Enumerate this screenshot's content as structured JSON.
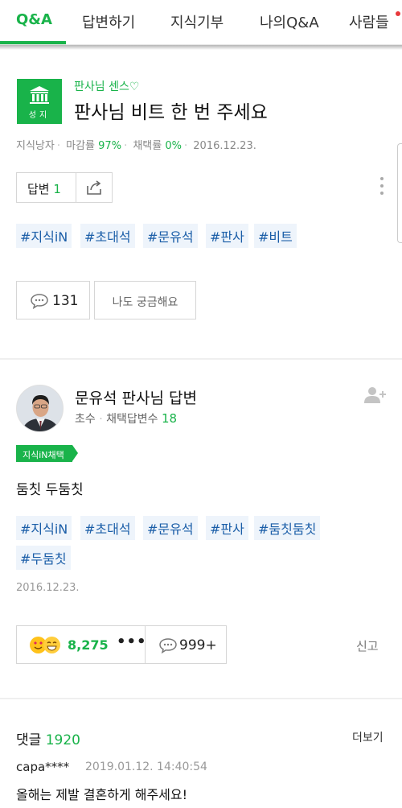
{
  "tabs": [
    {
      "label": "Q&A"
    },
    {
      "label": "답변하기"
    },
    {
      "label": "지식기부"
    },
    {
      "label": "나의Q&A"
    },
    {
      "label": "사람들"
    }
  ],
  "colors": {
    "accent": "#19b34a",
    "tag_text": "#1b5ea8",
    "tag_bg": "#eef4fb",
    "notification_dot": "#e8383b"
  },
  "question": {
    "badge_text": "성지",
    "badge_icon": "temple-icon",
    "category": "판사님 센스♡",
    "title": "판사님 비트 한 번 주세요",
    "meta": {
      "author": "지식낭자",
      "close_rate_label": "마감률",
      "close_rate": "97%",
      "adopt_rate_label": "채택률",
      "adopt_rate": "0%",
      "date": "2016.12.23."
    },
    "answer_label": "답변",
    "answer_count": "1",
    "tags": [
      "#지식iN",
      "#초대석",
      "#문유석",
      "#판사",
      "#비트"
    ],
    "comment_count": "131",
    "curious_label": "나도 궁금해요"
  },
  "answer": {
    "author_title": "문유석 판사님 답변",
    "level": "초수",
    "adopted_label": "채택답변수",
    "adopted_count": "18",
    "chosen_badge": "지식iN채택",
    "body": "둠칫 두둠칫",
    "tags": [
      "#지식iN",
      "#초대석",
      "#문유석",
      "#판사",
      "#둠칫둠칫",
      "#두둠칫"
    ],
    "date": "2016.12.23.",
    "reaction_count": "8,275",
    "more_label": "•••",
    "comment_count": "999+",
    "report_label": "신고"
  },
  "comments": {
    "title": "댓글",
    "count": "1920",
    "more_label": "더보기",
    "items": [
      {
        "author": "capa****",
        "time": "2019.01.12. 14:40:54",
        "text": "올해는 제발 결혼하게 해주세요!"
      }
    ]
  }
}
